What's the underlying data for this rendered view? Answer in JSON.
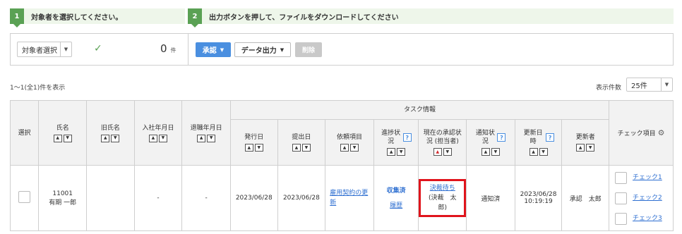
{
  "steps": [
    {
      "num": "1",
      "text": "対象者を選択してください。"
    },
    {
      "num": "2",
      "text": "出力ボタンを押して、ファイルをダウンロードしてください"
    }
  ],
  "toolbar": {
    "select_label": "対象者選択",
    "check_mark": "✓",
    "count": "0",
    "count_unit": "件",
    "approve_label": "承認",
    "export_label": "データ出力",
    "delete_label": "削除"
  },
  "list": {
    "range_text": "1～1(全1)件を表示",
    "per_page_label": "表示件数",
    "per_page_value": "25件"
  },
  "table": {
    "group_header": "タスク情報",
    "headers": {
      "select": "選択",
      "name": "氏名",
      "old_name": "旧氏名",
      "join_date": "入社年月日",
      "leave_date": "退職年月日",
      "issue_date": "発行日",
      "submit_date": "提出日",
      "request_item": "依頼項目",
      "progress": "進捗状況",
      "approval_status": "現在の承認状況 (担当者)",
      "notice_status": "通知状況",
      "updated_at": "更新日時",
      "updater": "更新者",
      "check_items": "チェック項目"
    },
    "rows": [
      {
        "code": "11001",
        "name": "有期 一郎",
        "old_name": "",
        "join_date": "-",
        "leave_date": "-",
        "issue_date": "2023/06/28",
        "submit_date": "2023/06/28",
        "request_item": "雇用契約の更新",
        "progress_status": "収集済",
        "progress_history": "履歴",
        "approval_status": "決裁待ち",
        "approval_person": "(決裁　太郎)",
        "notice_status": "通知済",
        "updated_date": "2023/06/28",
        "updated_time": "10:19:19",
        "updater": "承認　太郎",
        "checks": [
          "チェック1",
          "チェック2",
          "チェック3"
        ]
      }
    ]
  },
  "colors": {
    "step_green": "#5aa154",
    "approve_blue": "#4a8fe0",
    "link_blue": "#2e6fd1",
    "highlight_red": "#e0141c"
  }
}
